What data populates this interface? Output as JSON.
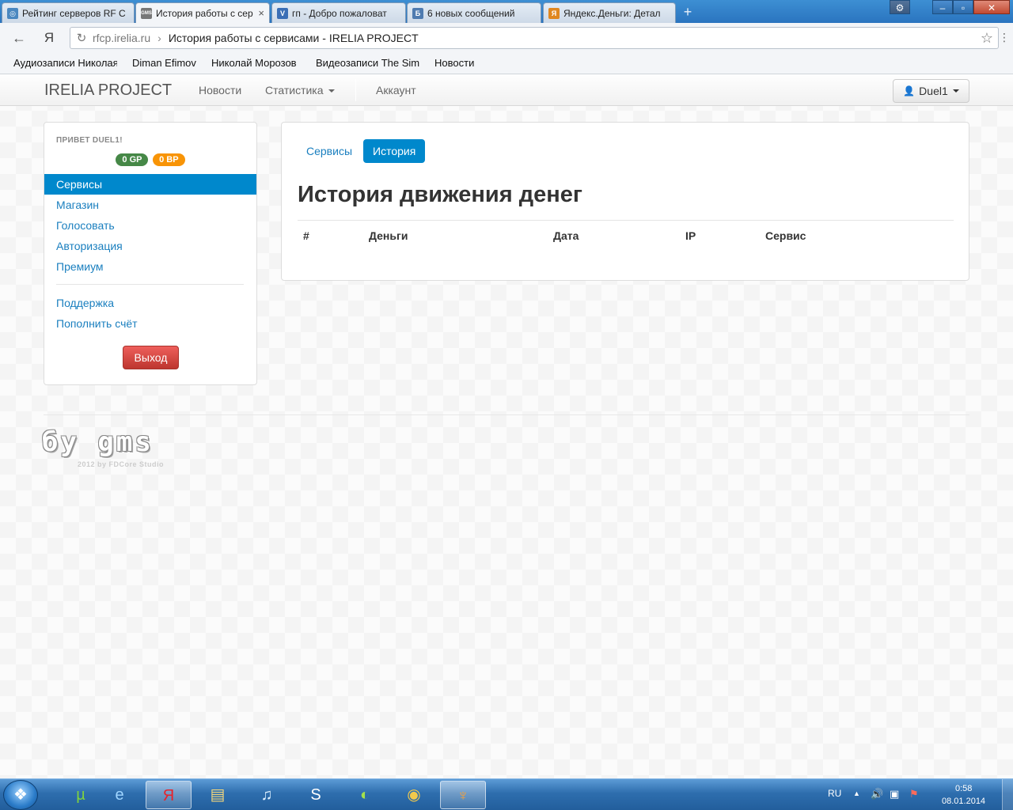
{
  "browser": {
    "tabs": [
      {
        "title": "Рейтинг серверов RF С",
        "active": false
      },
      {
        "title": "История работы с сер",
        "active": true
      },
      {
        "title": "гп - Добро пожаловат",
        "active": false
      },
      {
        "title": "6 новых сообщений",
        "active": false
      },
      {
        "title": "Яндекс.Деньги: Детал",
        "active": false
      }
    ],
    "favicons": [
      "◎",
      "GMS",
      "V",
      "Б",
      "Я"
    ],
    "new_tab": "+",
    "window_controls": {
      "settings": "⚙",
      "minimize": "–",
      "maximize": "▫",
      "close": "✕"
    },
    "address": {
      "domain": "rfcp.irelia.ru",
      "separator": "›",
      "title": "История работы с сервисами - IRELIA PROJECT"
    },
    "back": "←",
    "yandex": "Я",
    "bookmarks": [
      "Аудиозаписи Николая",
      "Diman Efimov",
      "Николай Морозов",
      "Видеозаписи The Simp",
      "Новости"
    ]
  },
  "navbar": {
    "brand": "IRELIA PROJECT",
    "links": [
      "Новости",
      "Статистика",
      "Аккаунт"
    ],
    "user": "Duel1"
  },
  "sidebar": {
    "greeting": "ПРИВЕТ DUEL1!",
    "badges": {
      "gp": "0 GP",
      "bp": "0 BP"
    },
    "items": [
      "Сервисы",
      "Магазин",
      "Голосовать",
      "Авторизация",
      "Премиум"
    ],
    "items2": [
      "Поддержка",
      "Пополнить счёт"
    ],
    "logout": "Выход"
  },
  "main": {
    "pills": [
      "Сервисы",
      "История"
    ],
    "title": "История движения денег",
    "columns": [
      "#",
      "Деньги",
      "Дата",
      "IP",
      "Сервис"
    ]
  },
  "footer": {
    "logo": "бу gms",
    "sub": "2012 by FDCore Studio"
  },
  "taskbar": {
    "lang": "RU",
    "time": "0:58",
    "date": "08.01.2014"
  },
  "colors": {
    "accent": "#0088cc",
    "danger": "#da4f49",
    "success": "#468847",
    "warning": "#f89406"
  }
}
